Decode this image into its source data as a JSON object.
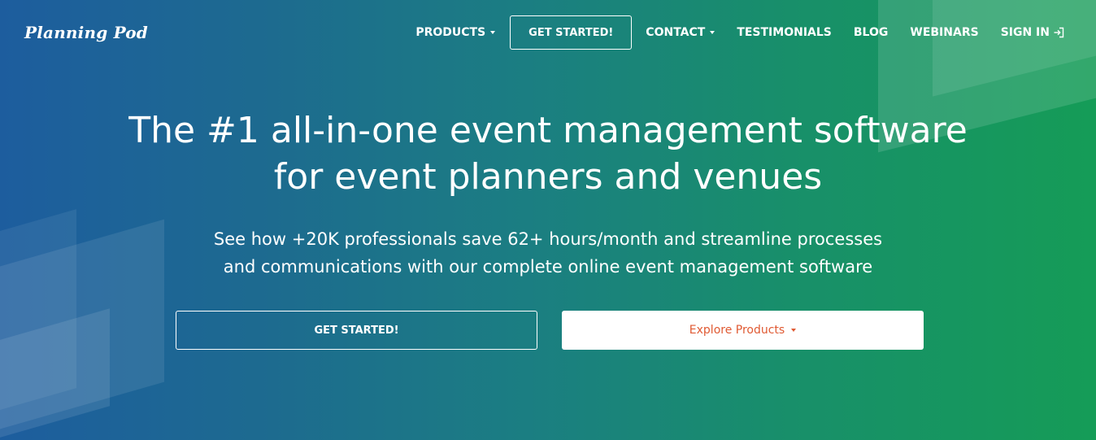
{
  "logo": {
    "text": "Planning Pod"
  },
  "nav": {
    "products": "PRODUCTS",
    "get_started": "GET STARTED!",
    "contact": "CONTACT",
    "testimonials": "TESTIMONIALS",
    "blog": "BLOG",
    "webinars": "WEBINARS",
    "sign_in": "SIGN IN"
  },
  "hero": {
    "headline_line1": "The #1 all-in-one event management software",
    "headline_line2": "for event planners and venues",
    "subline_line1": "See how +20K professionals save 62+ hours/month and streamline processes",
    "subline_line2": "and communications with our complete online event management software",
    "cta_primary": "GET STARTED!",
    "cta_secondary": "Explore Products"
  },
  "colors": {
    "gradient_left": "#1d5d9e",
    "gradient_right": "#159c57",
    "accent": "#e05a33",
    "text": "#ffffff"
  },
  "icons": [
    "chevron-down-icon",
    "sign-in-icon"
  ]
}
